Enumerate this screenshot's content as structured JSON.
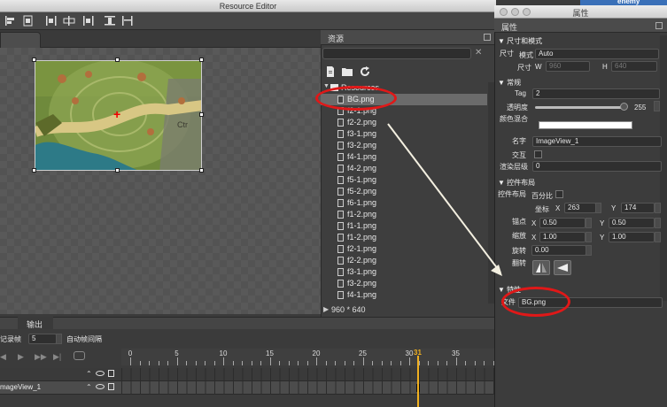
{
  "window": {
    "title": "Resource Editor"
  },
  "toolbar": {
    "icons": [
      "align-left-icon",
      "align-right-icon",
      "align-hcenter-icon",
      "distribute-h-icon",
      "align-top-icon",
      "distribute-v-icon"
    ]
  },
  "resources": {
    "title": "资源",
    "clear_symbol": "✕",
    "root_label": "Resources",
    "files": [
      "BG.png",
      "f2-1.png",
      "f2-2.png",
      "f3-1.png",
      "f3-2.png",
      "f4-1.png",
      "f4-2.png",
      "f5-1.png",
      "f5-2.png",
      "f6-1.png",
      "f1-2.png",
      "f1-1.png",
      "f1-2.png",
      "f2-1.png",
      "f2-2.png",
      "f3-1.png",
      "f3-2.png",
      "f4-1.png"
    ],
    "selected_file": "BG.png",
    "resolution": "960 * 640"
  },
  "properties": {
    "window_title": "属性",
    "panel_title": "属性",
    "size_section": "尺寸和模式",
    "size_label": "尺寸",
    "mode_label": "模式",
    "mode_value": "Auto",
    "dims_label": "尺寸",
    "w_label": "W",
    "w_value": "960",
    "h_label": "H",
    "h_value": "640",
    "general_section": "常规",
    "tag_label": "Tag",
    "tag_value": "2",
    "opacity_label": "透明度",
    "opacity_value": "255",
    "color_mix_label": "颜色混合",
    "name_label": "名字",
    "name_value": "ImageView_1",
    "interact_label": "交互",
    "render_layer_label": "渲染层级",
    "render_layer_value": "0",
    "layout_section": "控件布局",
    "layout_label": "控件布局",
    "percent_label": "百分比",
    "pos_label": "坐标",
    "pos_x_label": "X",
    "pos_x": "263",
    "pos_y_label": "Y",
    "pos_y": "174",
    "anchor_label": "锚点",
    "anchor_x_label": "X",
    "anchor_x": "0.50",
    "anchor_y_label": "Y",
    "anchor_y": "0.50",
    "scale_label": "缩放",
    "scale_x_label": "X",
    "scale_x": "1.00",
    "scale_y_label": "Y",
    "scale_y": "1.00",
    "rotate_label": "旋转",
    "rotate_value": "0.00",
    "flip_label": "翻转",
    "feature_section": "特性",
    "file_label": "文件",
    "file_value": "BG.png"
  },
  "timeline": {
    "tab_label": "输出",
    "record_label": "记录帧",
    "record_value": "5",
    "interval_label": "自动帧间隔",
    "ticks": [
      "0",
      "5",
      "10",
      "15",
      "20",
      "25",
      "30",
      "35"
    ],
    "current_frame": "31",
    "layer_name": "mageView_1"
  },
  "background_window": {
    "title": "enemy"
  },
  "colors": {
    "accent": "#f0b020",
    "annotation": "#e01818",
    "selected_row": "#6b6b6b"
  }
}
